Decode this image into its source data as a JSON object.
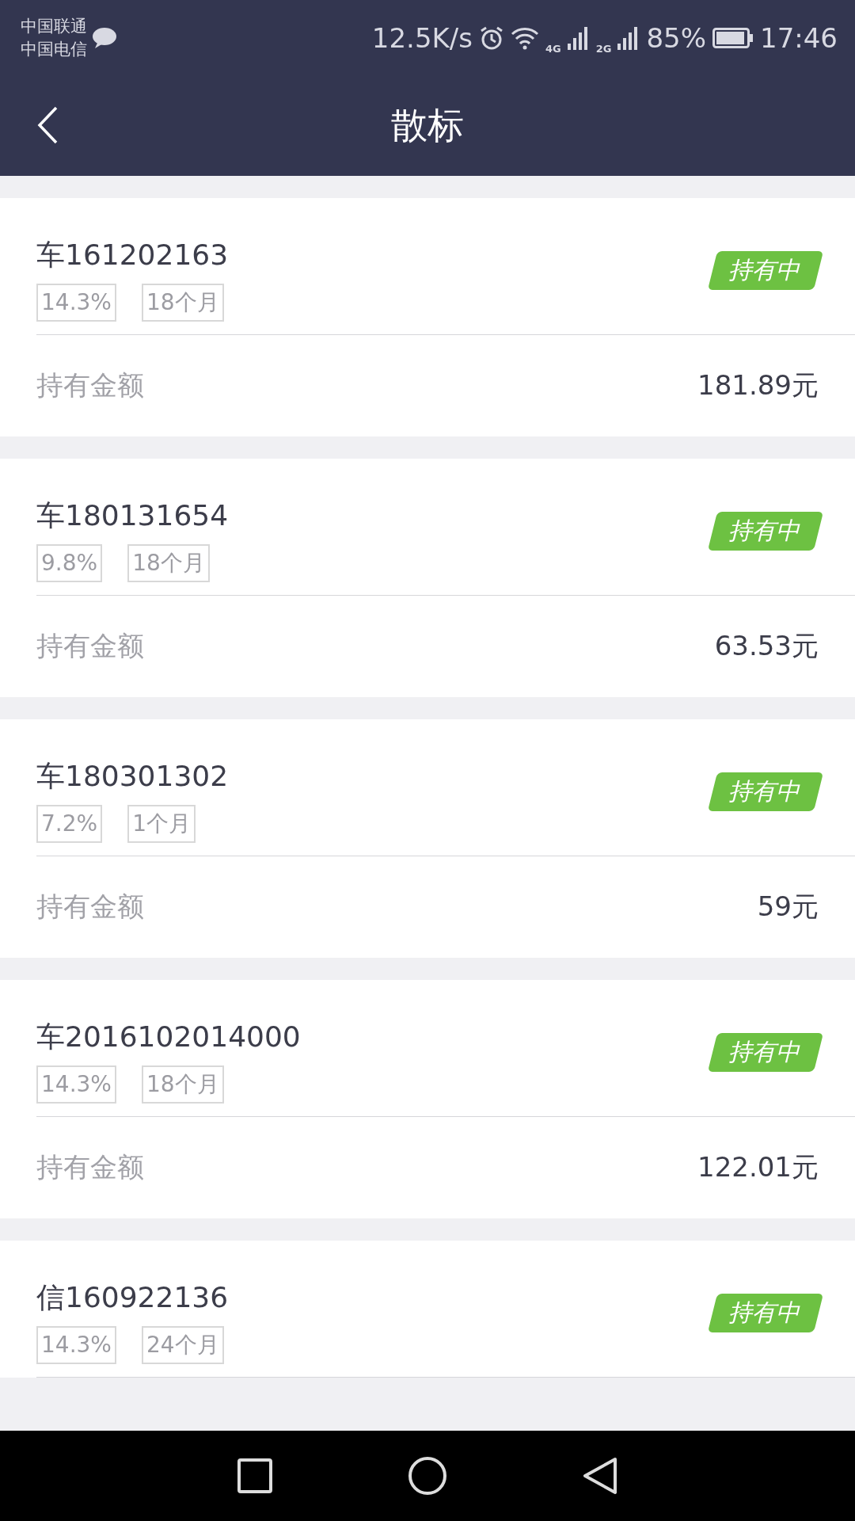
{
  "status_bar": {
    "carriers": [
      "中国联通",
      "中国电信"
    ],
    "speed": "12.5K/s",
    "network_1": "4G",
    "network_2": "2G",
    "battery": "85%",
    "time": "17:46"
  },
  "header": {
    "title": "散标"
  },
  "loans": [
    {
      "name": "车161202163",
      "rate": "14.3%",
      "term": "18个月",
      "status": "持有中",
      "amount_label": "持有金额",
      "amount": "181.89元"
    },
    {
      "name": "车180131654",
      "rate": "9.8%",
      "term": "18个月",
      "status": "持有中",
      "amount_label": "持有金额",
      "amount": "63.53元"
    },
    {
      "name": "车180301302",
      "rate": "7.2%",
      "term": "1个月",
      "status": "持有中",
      "amount_label": "持有金额",
      "amount": "59元"
    },
    {
      "name": "车2016102014000",
      "rate": "14.3%",
      "term": "18个月",
      "status": "持有中",
      "amount_label": "持有金额",
      "amount": "122.01元"
    },
    {
      "name": "信160922136",
      "rate": "14.3%",
      "term": "24个月",
      "status": "持有中"
    }
  ]
}
